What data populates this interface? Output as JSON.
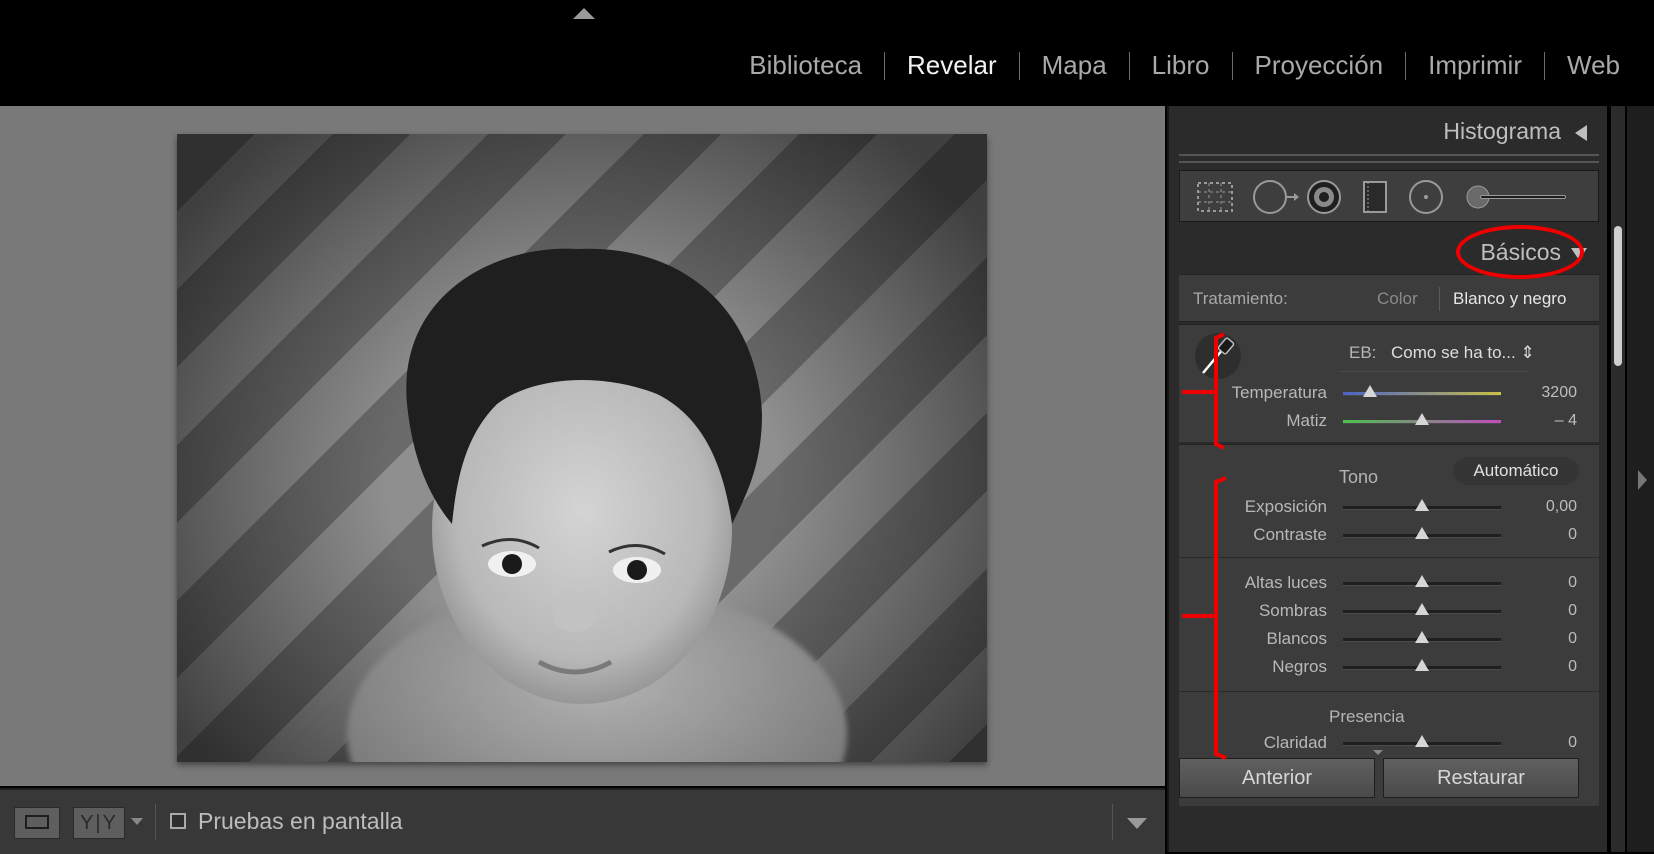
{
  "modules": [
    "Biblioteca",
    "Revelar",
    "Mapa",
    "Libro",
    "Proyección",
    "Imprimir",
    "Web"
  ],
  "active_module": "Revelar",
  "panel": {
    "histogram_title": "Histograma",
    "basic_title": "Básicos",
    "treatment": {
      "label": "Tratamiento:",
      "option_color": "Color",
      "option_bw": "Blanco y negro"
    },
    "white_balance": {
      "label": "EB:",
      "value": "Como se ha to... ⇕"
    },
    "sliders": [
      {
        "label": "Temperatura",
        "value": "3200",
        "position": 0.17
      },
      {
        "label": "Matiz",
        "value": "– 4",
        "position": 0.5
      },
      {
        "label": "Exposición",
        "value": "0,00",
        "position": 0.5
      },
      {
        "label": "Contraste",
        "value": "0",
        "position": 0.5
      },
      {
        "label": "Altas luces",
        "value": "0",
        "position": 0.5
      },
      {
        "label": "Sombras",
        "value": "0",
        "position": 0.5
      },
      {
        "label": "Blancos",
        "value": "0",
        "position": 0.5
      },
      {
        "label": "Negros",
        "value": "0",
        "position": 0.5
      },
      {
        "label": "Claridad",
        "value": "0",
        "position": 0.5
      }
    ],
    "tone_title": "Tono",
    "auto_button": "Automático",
    "presence_title": "Presencia",
    "prev_button": "Anterior",
    "reset_button": "Restaurar"
  },
  "toolbar": {
    "softproof_label": "Pruebas en pantalla",
    "compare_label": "Y|Y"
  },
  "colors": {
    "accent_red": "#e00000",
    "panel_bg": "#3c3c3c",
    "viewer_bg": "#797979"
  }
}
